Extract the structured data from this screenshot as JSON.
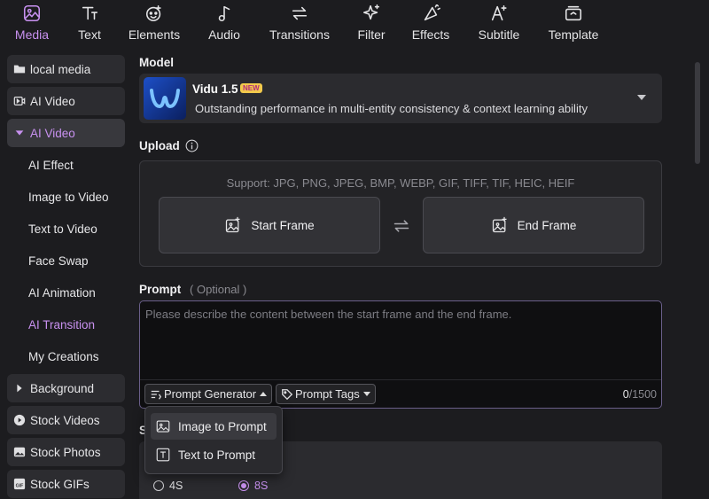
{
  "toolbar": {
    "items": [
      {
        "label": "Media",
        "icon": "media-icon",
        "active": true
      },
      {
        "label": "Text",
        "icon": "text-icon"
      },
      {
        "label": "Elements",
        "icon": "elements-icon"
      },
      {
        "label": "Audio",
        "icon": "music-note-icon"
      },
      {
        "label": "Transitions",
        "icon": "transitions-icon"
      },
      {
        "label": "Filter",
        "icon": "sparkle-icon"
      },
      {
        "label": "Effects",
        "icon": "effects-icon"
      },
      {
        "label": "Subtitle",
        "icon": "subtitle-icon"
      },
      {
        "label": "Template",
        "icon": "template-icon"
      }
    ]
  },
  "sidebar": {
    "items": [
      {
        "label": "local media",
        "icon": "folder-icon"
      },
      {
        "label": "AI Video",
        "icon": "ai-video-icon"
      },
      {
        "label": "AI Video",
        "icon": "caret-down-icon"
      },
      {
        "label": "AI Effect"
      },
      {
        "label": "Image to Video"
      },
      {
        "label": "Text to Video"
      },
      {
        "label": "Face Swap"
      },
      {
        "label": "AI Animation"
      },
      {
        "label": "AI Transition"
      },
      {
        "label": "My Creations"
      },
      {
        "label": "Background",
        "icon": "caret-right-icon"
      },
      {
        "label": "Stock Videos",
        "icon": "play-icon"
      },
      {
        "label": "Stock Photos",
        "icon": "photo-icon"
      },
      {
        "label": "Stock GIFs",
        "icon": "gif-icon"
      }
    ]
  },
  "model": {
    "heading": "Model",
    "name": "Vidu 1.5",
    "badge": "NEW",
    "description": "Outstanding performance in multi-entity consistency & context learning ability"
  },
  "upload": {
    "heading": "Upload",
    "support": "Support: JPG, PNG, JPEG, BMP, WEBP, GIF, TIFF, TIF, HEIC, HEIF",
    "start_label": "Start Frame",
    "end_label": "End Frame"
  },
  "prompt": {
    "heading": "Prompt",
    "optional": "( Optional )",
    "placeholder": "Please describe the content between the start frame and the end frame.",
    "value": "",
    "generator_label": "Prompt Generator",
    "tags_label": "Prompt Tags",
    "count_current": "0",
    "count_max": "/1500"
  },
  "menu": {
    "items": [
      {
        "label": "Image to Prompt",
        "icon": "image-icon"
      },
      {
        "label": "Text to Prompt",
        "icon": "text-box-icon"
      }
    ]
  },
  "duration": {
    "heading_partial": "S",
    "options": [
      {
        "label": "4S",
        "selected": false
      },
      {
        "label": "8S",
        "selected": true
      }
    ]
  },
  "colors": {
    "accent": "#c891f0",
    "background": "#1c1c1f",
    "panel": "#2b2b2f"
  }
}
